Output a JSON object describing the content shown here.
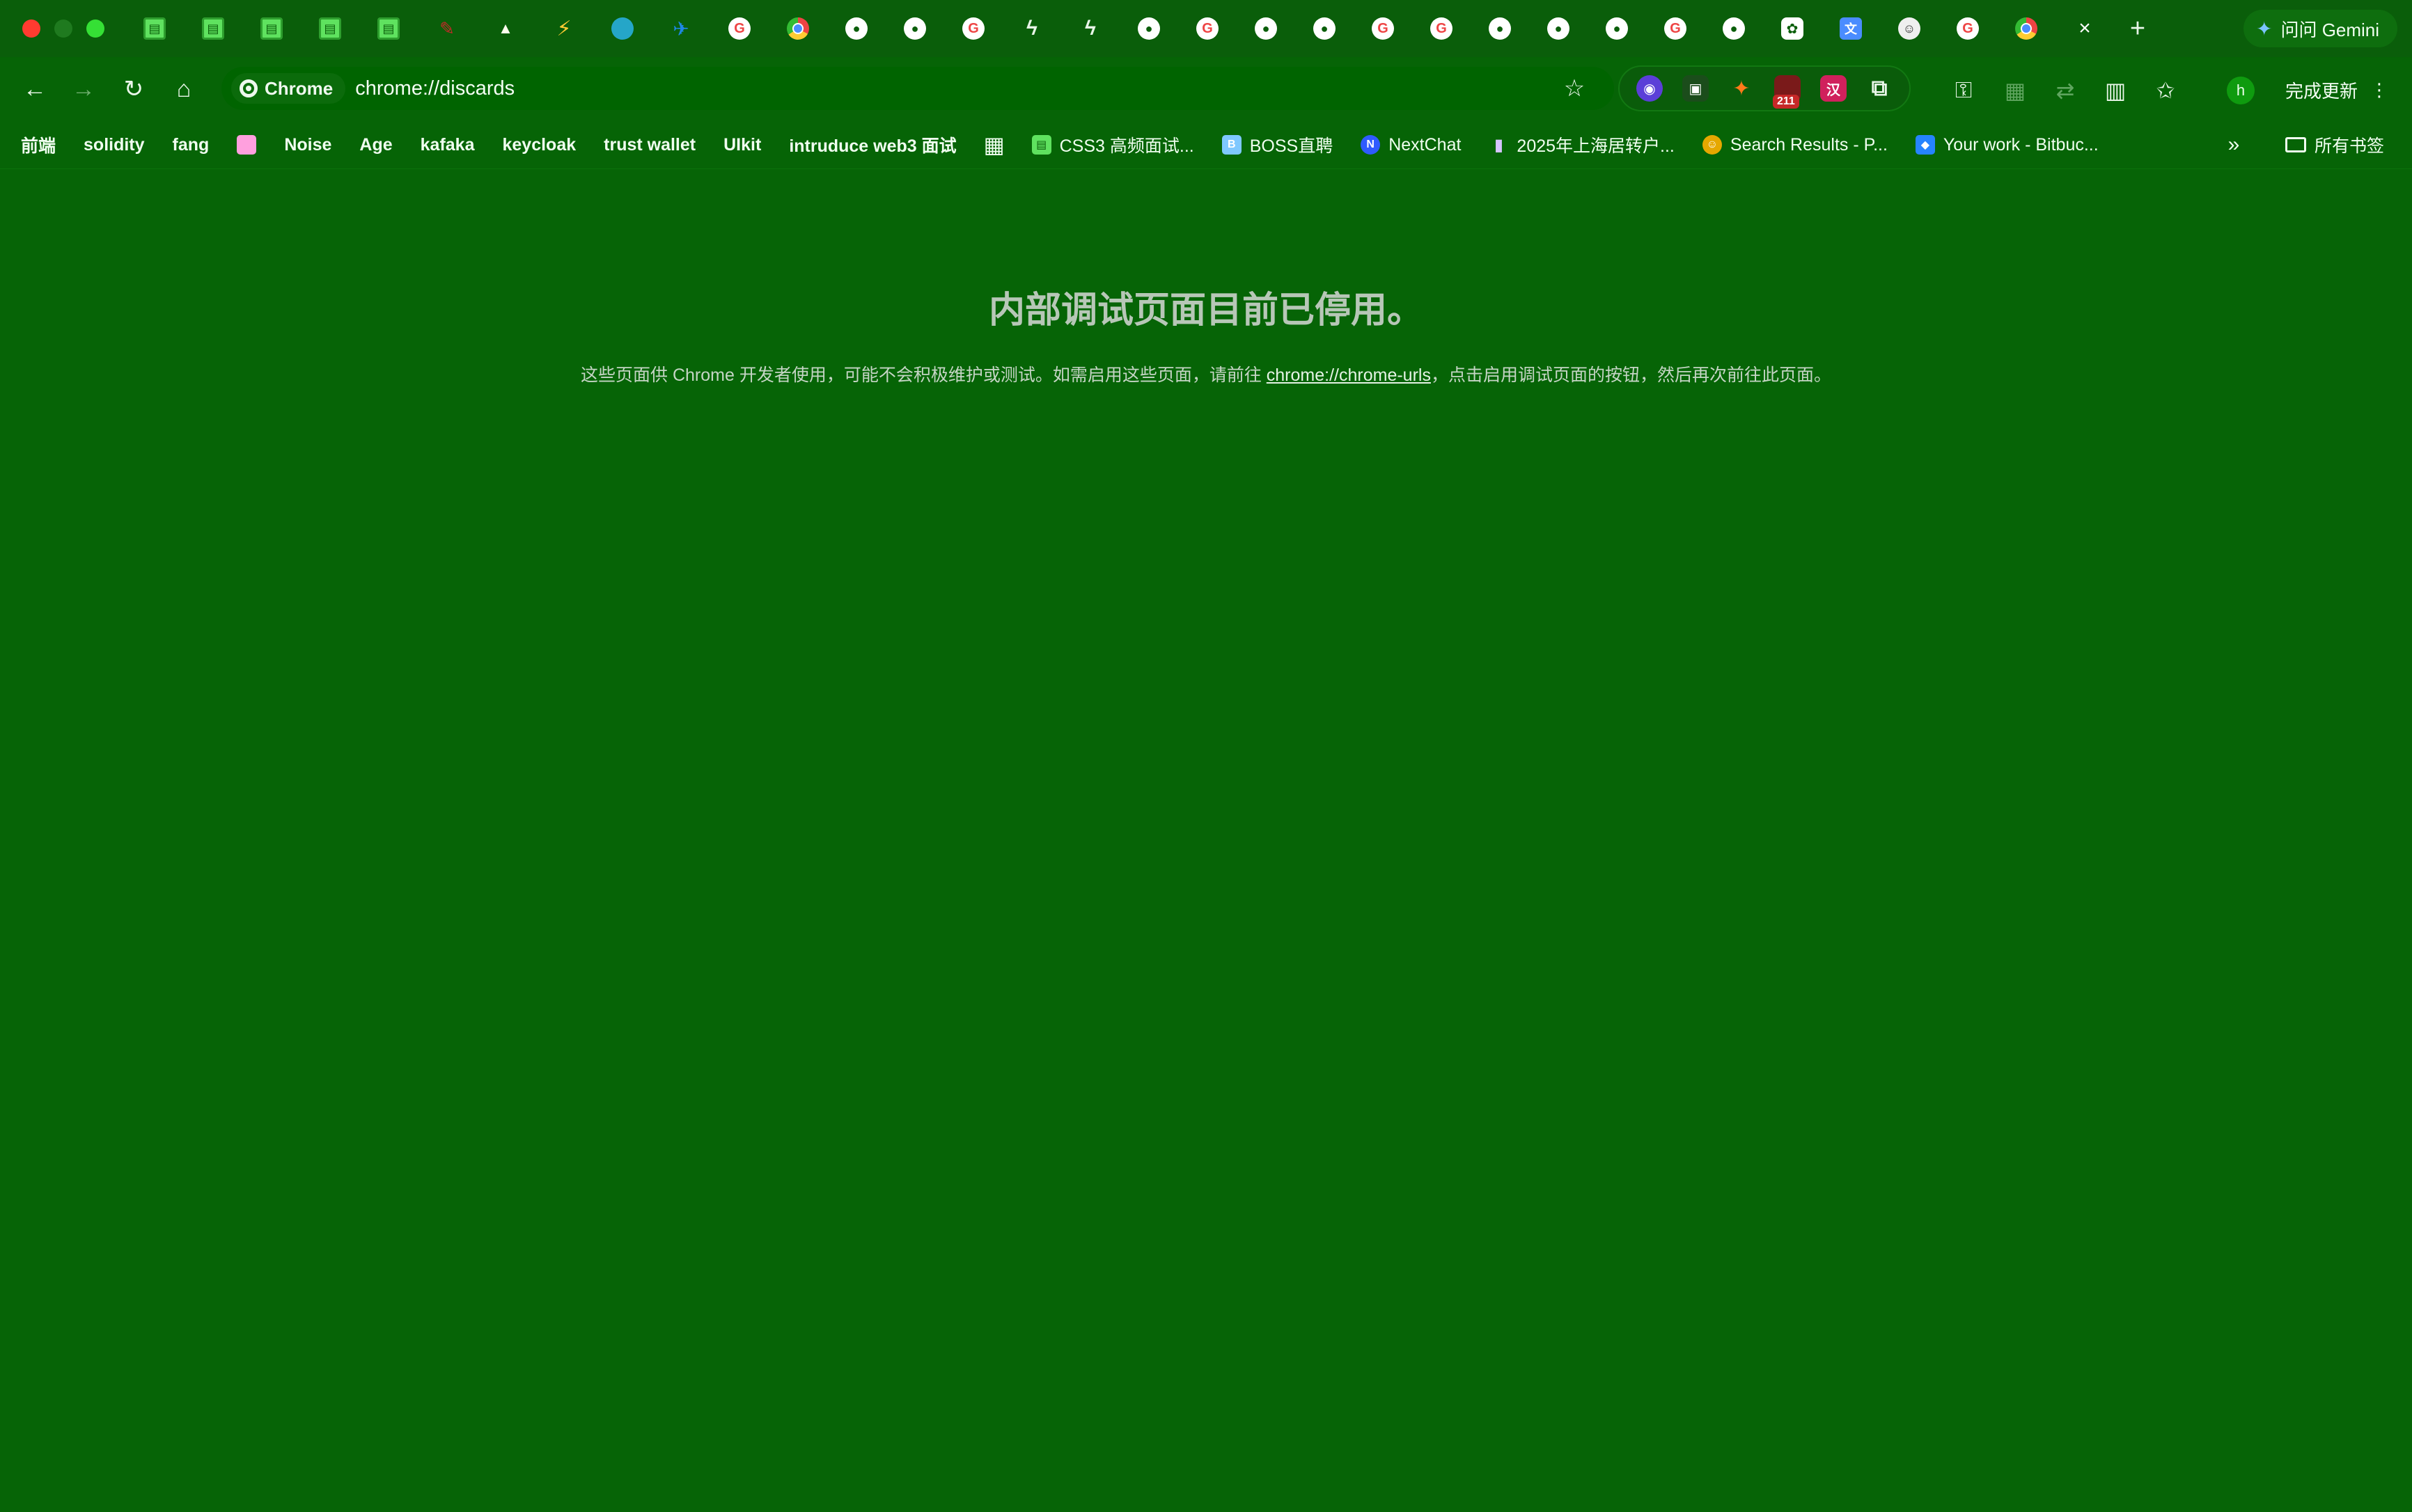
{
  "window": {
    "gemini_label": "问问 Gemini",
    "new_tab_glyph": "+"
  },
  "tabs": [
    {
      "icon": "spreadsheet-icon",
      "glyph": "▤"
    },
    {
      "icon": "spreadsheet-icon",
      "glyph": "▤"
    },
    {
      "icon": "spreadsheet-icon",
      "glyph": "▤"
    },
    {
      "icon": "spreadsheet-icon",
      "glyph": "▤"
    },
    {
      "icon": "spreadsheet-icon",
      "glyph": "▤"
    },
    {
      "icon": "feather-icon",
      "glyph": "✎"
    },
    {
      "icon": "triangle-icon",
      "glyph": "▲"
    },
    {
      "icon": "vite-icon",
      "glyph": "⚡"
    },
    {
      "icon": "swirl-icon",
      "glyph": ""
    },
    {
      "icon": "bird-icon",
      "glyph": "✈"
    },
    {
      "icon": "google-icon",
      "glyph": "G"
    },
    {
      "icon": "chrome-icon",
      "glyph": ""
    },
    {
      "icon": "github-icon",
      "glyph": "●"
    },
    {
      "icon": "github-icon",
      "glyph": "●"
    },
    {
      "icon": "google-icon",
      "glyph": "G"
    },
    {
      "icon": "bolt-icon",
      "glyph": "ϟ"
    },
    {
      "icon": "bolt-icon",
      "glyph": "ϟ"
    },
    {
      "icon": "github-icon",
      "glyph": "●"
    },
    {
      "icon": "google-icon",
      "glyph": "G"
    },
    {
      "icon": "github-icon",
      "glyph": "●"
    },
    {
      "icon": "github-icon",
      "glyph": "●"
    },
    {
      "icon": "google-icon",
      "glyph": "G"
    },
    {
      "icon": "google-icon",
      "glyph": "G"
    },
    {
      "icon": "github-icon",
      "glyph": "●"
    },
    {
      "icon": "github-icon",
      "glyph": "●"
    },
    {
      "icon": "github-icon",
      "glyph": "●"
    },
    {
      "icon": "google-icon",
      "glyph": "G"
    },
    {
      "icon": "github-icon",
      "glyph": "●"
    },
    {
      "icon": "openai-icon",
      "glyph": "✿"
    },
    {
      "icon": "translate-icon",
      "glyph": "文"
    },
    {
      "icon": "person-icon",
      "glyph": "☺"
    },
    {
      "icon": "google-icon",
      "glyph": "G"
    },
    {
      "icon": "chrome-icon",
      "glyph": ""
    }
  ],
  "active_tab_close_glyph": "×",
  "toolbar": {
    "chip_label": "Chrome",
    "url": "chrome://discards",
    "update_label": "完成更新",
    "avatar_letter": "h",
    "ext_badge": "211",
    "ext_labels": [
      "◉",
      "▣",
      "✦",
      "",
      "汉",
      "⧉"
    ]
  },
  "bookmarks": [
    {
      "label": "前端",
      "icon": "",
      "bold": true
    },
    {
      "label": "solidity",
      "icon": "",
      "bold": true
    },
    {
      "label": "fang",
      "icon": "",
      "bold": true
    },
    {
      "label": "",
      "icon": "pink"
    },
    {
      "label": "Noise",
      "icon": "",
      "bold": true
    },
    {
      "label": "Age",
      "icon": "",
      "bold": true
    },
    {
      "label": "kafaka",
      "icon": "",
      "bold": true
    },
    {
      "label": "keycloak",
      "icon": "",
      "bold": true
    },
    {
      "label": "trust wallet",
      "icon": "",
      "bold": true
    },
    {
      "label": "UIkit",
      "icon": "",
      "bold": true
    },
    {
      "label": "intruduce web3 面试",
      "icon": "",
      "bold": true
    },
    {
      "label": "",
      "icon": "apps"
    },
    {
      "label": "CSS3 高频面试...",
      "icon": "sheet"
    },
    {
      "label": "BOSS直聘",
      "icon": "boss"
    },
    {
      "label": "NextChat",
      "icon": "nc"
    },
    {
      "label": "2025年上海居转户...",
      "icon": "stats"
    },
    {
      "label": "Search Results - P...",
      "icon": "search"
    },
    {
      "label": "Your work - Bitbuc...",
      "icon": "bb"
    }
  ],
  "bookmarks_more": "»",
  "all_bookmarks": "所有书签",
  "content": {
    "heading": "内部调试页面目前已停用。",
    "desc_before": "这些页面供 Chrome 开发者使用，可能不会积极维护或测试。如需启用这些页面，请前往 ",
    "desc_link": "chrome://chrome-urls",
    "desc_after": "，点击启用调试页面的按钮，然后再次前往此页面。"
  },
  "colors": {
    "background": "#066406",
    "tabstrip": "#0a5e0a",
    "heading": "#b7c7b7"
  }
}
